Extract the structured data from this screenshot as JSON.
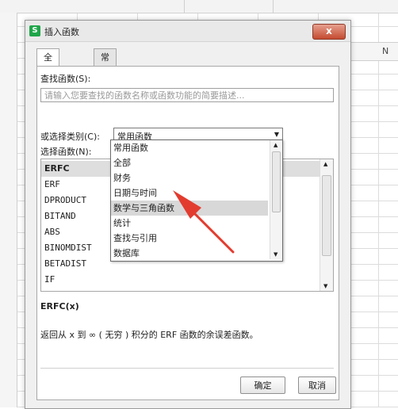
{
  "window": {
    "title": "插入函数",
    "app_icon": "S",
    "close_icon": "x"
  },
  "tabs": [
    {
      "label": "全部函数",
      "active": true
    },
    {
      "label": "常用公式",
      "active": false
    }
  ],
  "search": {
    "label": "查找函数(S):",
    "placeholder": "请输入您要查找的函数名称或函数功能的简要描述..."
  },
  "category": {
    "label": "或选择类别(C):",
    "selected": "常用函数"
  },
  "function_list": {
    "label": "选择函数(N):",
    "items": [
      "ERFC",
      "ERF",
      "DPRODUCT",
      "BITAND",
      "ABS",
      "BINOMDIST",
      "BETADIST",
      "IF"
    ],
    "selected_index": 0
  },
  "category_dropdown": {
    "options": [
      "常用函数",
      "全部",
      "财务",
      "日期与时间",
      "数学与三角函数",
      "统计",
      "查找与引用",
      "数据库"
    ],
    "highlighted_index": 4
  },
  "syntax": "ERFC(x)",
  "description": "返回从 x 到 ∞ ( 无穷 ) 积分的 ERF 函数的余误差函数。",
  "buttons": {
    "ok": "确定",
    "cancel": "取消"
  },
  "sheet": {
    "column_letter": "N"
  },
  "annotation": {
    "color": "#e23c2f"
  }
}
